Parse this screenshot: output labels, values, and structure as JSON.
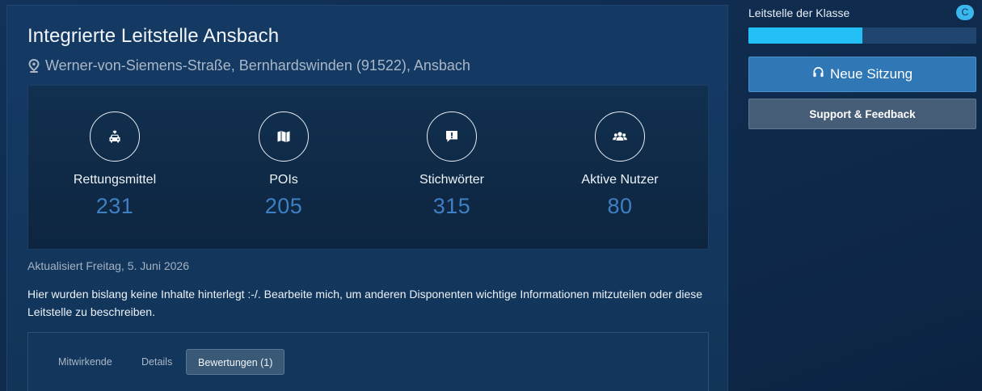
{
  "center": {
    "title": "Integrierte Leitstelle Ansbach",
    "address": "Werner-von-Siemens-Straße, Bernhardswinden (91522), Ansbach",
    "address_icon": "map-pin-icon"
  },
  "stats": [
    {
      "label": "Rettungsmittel",
      "value": "231",
      "icon": "ambulance-icon"
    },
    {
      "label": "POIs",
      "value": "205",
      "icon": "map-icon"
    },
    {
      "label": "Stichwörter",
      "value": "315",
      "icon": "alert-comment-icon"
    },
    {
      "label": "Aktive Nutzer",
      "value": "80",
      "icon": "users-icon"
    }
  ],
  "updated": "Aktualisiert Freitag, 5. Juni 2026",
  "description": "Hier wurden bislang keine Inhalte hinterlegt :-/. Bearbeite mich, um anderen Disponenten wichtige Informationen mitzuteilen oder diese Leitstelle zu beschreiben.",
  "tabs": [
    {
      "label": "Mitwirkende",
      "active": false
    },
    {
      "label": "Details",
      "active": false
    },
    {
      "label": "Bewertungen (1)",
      "active": true
    }
  ],
  "sidebar": {
    "class_label": "Leitstelle der Klasse",
    "class_badge": "C",
    "class_progress_fraction": 0.5,
    "new_session_label": "Neue Sitzung",
    "new_session_icon": "headset-icon",
    "support_label": "Support & Feedback"
  },
  "colors": {
    "accent": "#2f77b5",
    "progress": "#22c0f4",
    "stat_value": "#3f7fc4",
    "badge": "#3ab7ee"
  }
}
